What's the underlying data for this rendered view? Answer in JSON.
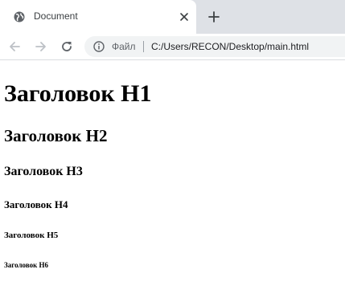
{
  "tab": {
    "title": "Document",
    "favicon_icon": "globe-icon",
    "close_icon": "close-icon"
  },
  "new_tab_icon": "plus-icon",
  "toolbar": {
    "back_icon": "arrow-left-icon",
    "forward_icon": "arrow-right-icon",
    "reload_icon": "reload-icon"
  },
  "omnibox": {
    "info_icon": "info-icon",
    "scheme_label": "Файл",
    "url": "C:/Users/RECON/Desktop/main.html"
  },
  "page": {
    "h1": "Заголовок H1",
    "h2": "Заголовок H2",
    "h3": "Заголовок H3",
    "h4": "Заголовок H4",
    "h5": "Заголовок H5",
    "h6": "Заголовок H6"
  },
  "colors": {
    "tabstrip_bg": "#dee1e6",
    "omnibox_bg": "#f1f3f4",
    "icon_gray": "#5f6368",
    "disabled_icon": "#bdc1c6"
  }
}
